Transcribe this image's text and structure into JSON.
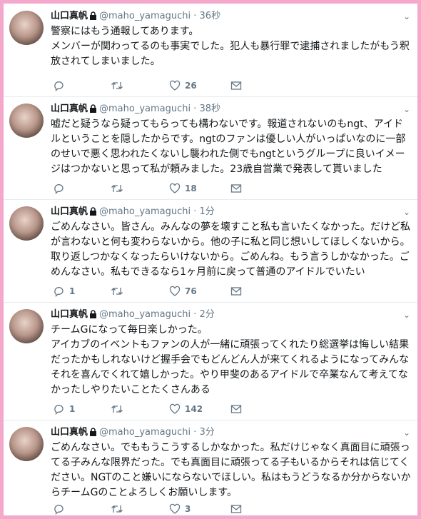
{
  "tweets": [
    {
      "name": "山口真帆",
      "handle": "@maho_yamaguchi",
      "time": "36秒",
      "text": "警察にはもう通報してあります。\nメンバーが関わってるのも事実でした。犯人も暴行罪で逮捕されましたがもう釈放されてしまいました。",
      "replies": "",
      "retweets": "",
      "likes": "26"
    },
    {
      "name": "山口真帆",
      "handle": "@maho_yamaguchi",
      "time": "38秒",
      "text": "嘘だと疑うなら疑ってもらっても構わないです。報道されないのもngt、アイドルということを隠したからです。ngtのファンは優しい人がいっぱいなのに一部のせいで悪く思われたくないし襲われた側でもngtというグループに良いイメージはつかないと思って私が頼みました。23歳自営業で発表して貰いました",
      "replies": "",
      "retweets": "",
      "likes": "18"
    },
    {
      "name": "山口真帆",
      "handle": "@maho_yamaguchi",
      "time": "1分",
      "text": "ごめんなさい。皆さん。みんなの夢を壊すこと私も言いたくなかった。だけど私が言わないと何も変わらないから。他の子に私と同じ想いしてほしくないから。取り返しつかなくなったらいけないから。ごめんね。もう言うしかなかった。ごめんなさい。私もできるなら1ヶ月前に戻って普通のアイドルでいたい",
      "replies": "1",
      "retweets": "",
      "likes": "76"
    },
    {
      "name": "山口真帆",
      "handle": "@maho_yamaguchi",
      "time": "2分",
      "text": "チームGになって毎日楽しかった。\nアイカブのイベントもファンの人が一緒に頑張ってくれたり総選挙は悔しい結果だったかもしれないけど握手会でもどんどん人が来てくれるようになってみんなそれを喜んでくれて嬉しかった。やり甲斐のあるアイドルで卒業なんて考えてなかったしやりたいことたくさんある",
      "replies": "1",
      "retweets": "",
      "likes": "142"
    },
    {
      "name": "山口真帆",
      "handle": "@maho_yamaguchi",
      "time": "3分",
      "text": "ごめんなさい。でももうこうするしかなかった。私だけじゃなく真面目に頑張ってる子みんな限界だった。でも真面目に頑張ってる子もいるからそれは信じてください。NGTのこと嫌いにならないでほしい。私はもうどうなるか分からないからチームGのことよろしくお願いします。",
      "replies": "",
      "retweets": "",
      "likes": "3"
    }
  ]
}
